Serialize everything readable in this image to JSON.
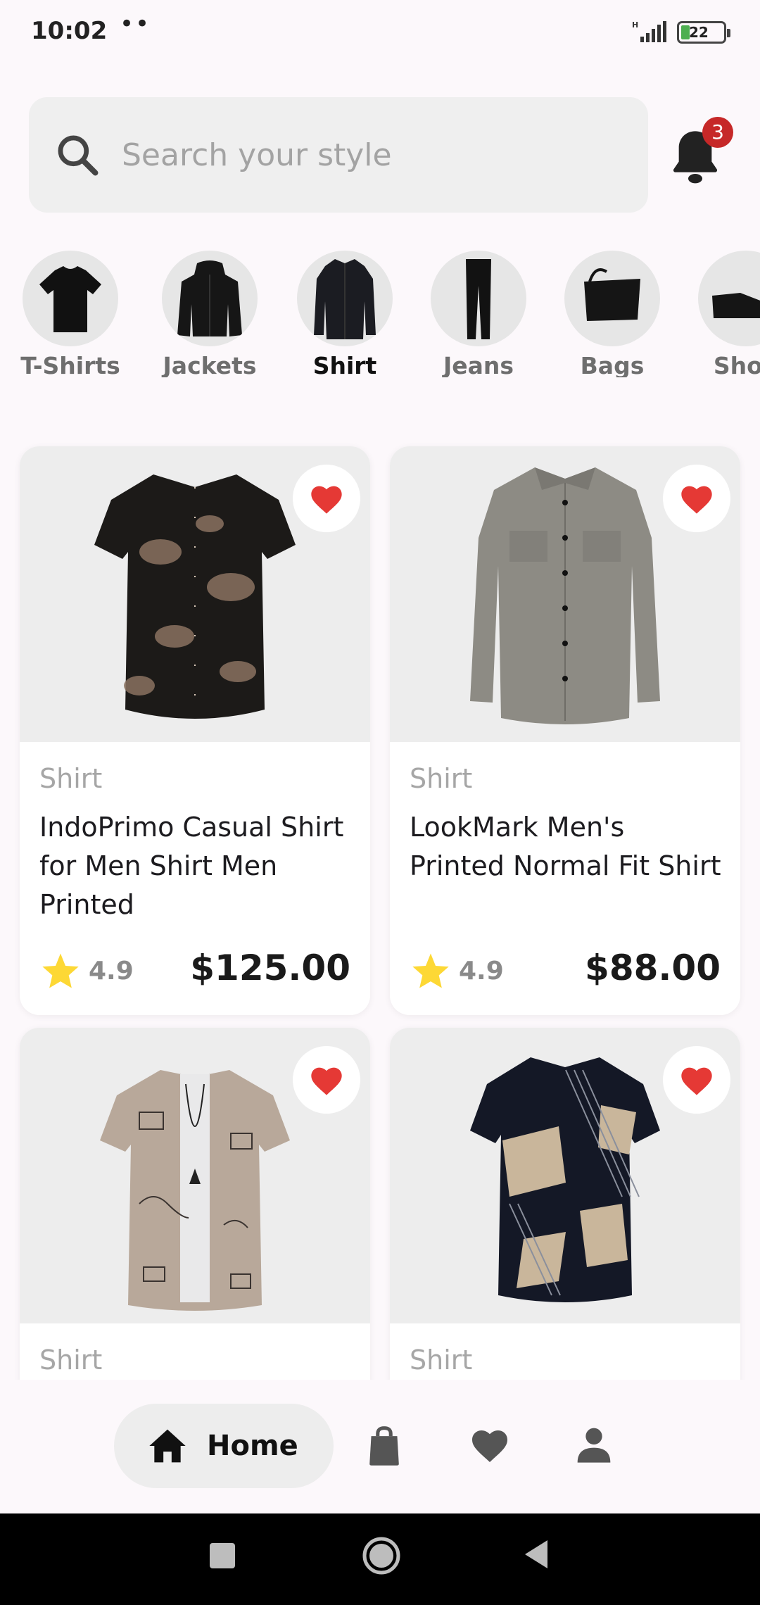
{
  "status": {
    "time": "10:02",
    "dots": "••",
    "battery": "22"
  },
  "search": {
    "placeholder": "Search your style"
  },
  "notifications": {
    "count": "3"
  },
  "categories": [
    {
      "label": "T-Shirts"
    },
    {
      "label": "Jackets"
    },
    {
      "label": "Shirt"
    },
    {
      "label": "Jeans"
    },
    {
      "label": "Bags"
    },
    {
      "label": "Shoe"
    }
  ],
  "selected_category": "Shirt",
  "products": [
    {
      "category": "Shirt",
      "title": "IndoPrimo Casual Shirt for Men Shirt Men Printed",
      "rating": "4.9",
      "price": "$125.00"
    },
    {
      "category": "Shirt",
      "title": "LookMark Men's Printed Normal Fit Shirt",
      "rating": "4.9",
      "price": "$88.00"
    },
    {
      "category": "Shirt",
      "title": "",
      "rating": "",
      "price": ""
    },
    {
      "category": "Shirt",
      "title": "",
      "rating": "",
      "price": ""
    }
  ],
  "nav": {
    "home_label": "Home"
  },
  "colors": {
    "favorite": "#e53935",
    "star": "#fdd835",
    "badge": "#c62828",
    "background": "#fcf8fb"
  },
  "icons": {
    "search": "search-icon",
    "bell": "bell-icon",
    "heart": "heart-icon",
    "star": "star-icon",
    "home": "home-icon",
    "bag": "shopping-bag-icon",
    "profile": "person-icon"
  }
}
